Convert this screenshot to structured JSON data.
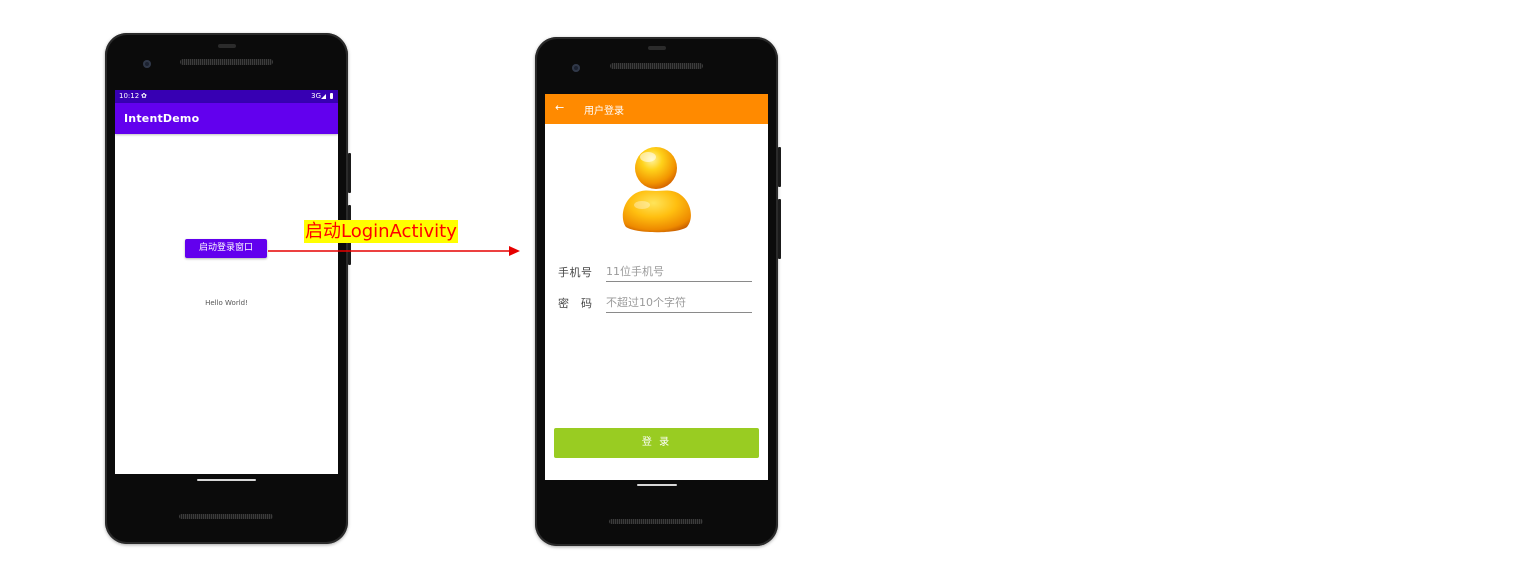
{
  "phone_left": {
    "status_bar": {
      "time": "10:12",
      "network": "3G"
    },
    "app_title": "IntentDemo",
    "launch_button_label": "启动登录窗口",
    "hello_text": "Hello World!"
  },
  "arrow_caption": "启动LoginActivity",
  "phone_right": {
    "title": "用户登录",
    "phone_label": "手机号",
    "phone_placeholder": "11位手机号",
    "password_label": "密　码",
    "password_placeholder": "不超过10个字符",
    "login_button_label": "登 录"
  },
  "colors": {
    "status_bar": "#3700b3",
    "app_bar": "#6200ee",
    "login_bar": "#ff8a00",
    "login_button": "#99cc22",
    "arrow": "#e60000",
    "caption_highlight": "#ffff00",
    "caption_text": "#ff0000"
  },
  "icons": {
    "status_settings": "gear-icon",
    "status_signal": "signal-icon",
    "status_battery": "battery-icon",
    "back": "arrow-left-icon",
    "avatar": "user-avatar-icon"
  }
}
